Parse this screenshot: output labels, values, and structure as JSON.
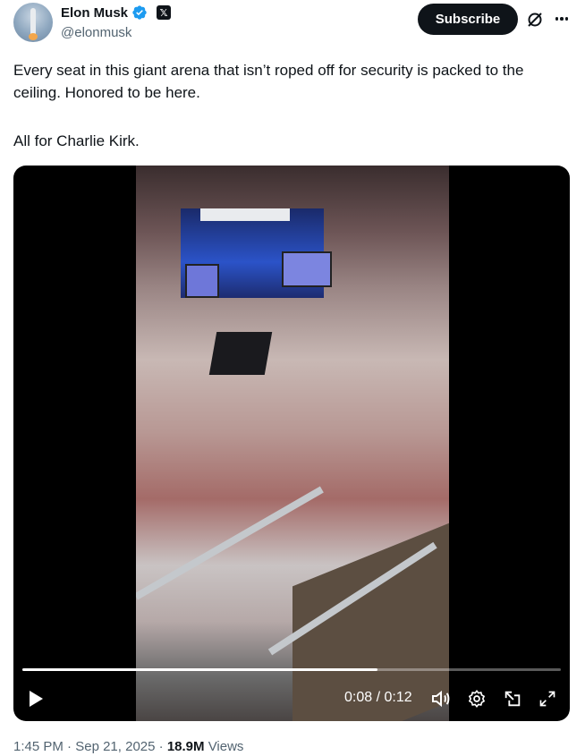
{
  "author": {
    "name": "Elon Musk",
    "handle": "@elonmusk",
    "verified_icon": "verified-badge-icon",
    "affiliation_icon": "x-logo-icon"
  },
  "actions": {
    "subscribe_label": "Subscribe",
    "grok_icon": "grok-icon",
    "more_icon": "more-icon"
  },
  "tweet": {
    "line1": "Every seat in this giant arena that isn’t roped off for security is packed to the ceiling. Honored to be here.",
    "line2": "All for Charlie Kirk."
  },
  "video": {
    "current_time": "0:08",
    "duration": "0:12",
    "time_display": "0:08 / 0:12",
    "progress": 0.66,
    "controls": [
      "play-icon",
      "volume-icon",
      "settings-icon",
      "popout-icon",
      "fullscreen-icon"
    ]
  },
  "meta": {
    "time": "1:45 PM",
    "date": "Sep 21, 2025",
    "views_count": "18.9M",
    "views_label": "Views"
  },
  "colors": {
    "text": "#0f1419",
    "secondary": "#536471",
    "verified": "#1d9bf0",
    "button_bg": "#0f1419"
  }
}
